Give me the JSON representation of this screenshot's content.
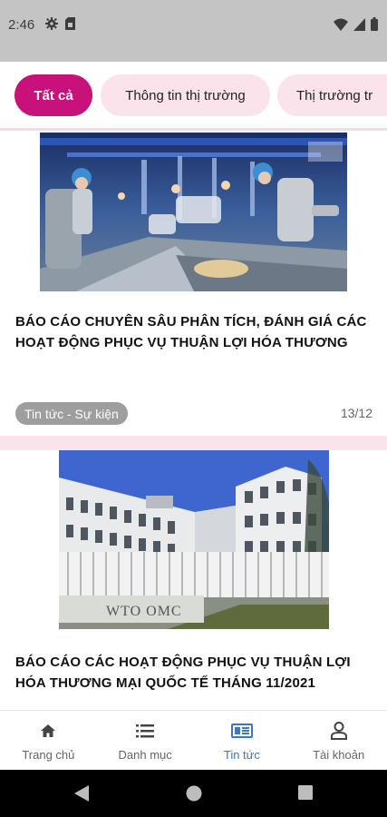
{
  "status_bar": {
    "time": "2:46",
    "icons": [
      "gear-icon",
      "sim-card-icon",
      "wifi-icon",
      "signal-icon",
      "battery-icon"
    ]
  },
  "filters": {
    "chips": [
      {
        "label": "Tất cả",
        "active": true
      },
      {
        "label": "Thông tin thị trường",
        "active": false
      },
      {
        "label": "Thị trường tr",
        "active": false
      }
    ]
  },
  "articles": [
    {
      "title": "BÁO CÁO CHUYÊN SÂU PHÂN TÍCH, ĐÁNH GIÁ CÁC HOẠT ĐỘNG PHỤC VỤ THUẬN LỢI HÓA THƯƠNG",
      "tag": "Tin tức - Sự kiện",
      "date": "13/12",
      "image": "factory-workers-photo"
    },
    {
      "title": "BÁO CÁO CÁC HOẠT ĐỘNG PHỤC VỤ THUẬN LỢI HÓA THƯƠNG MẠI QUỐC TẾ THÁNG 11/2021",
      "image": "wto-building-photo",
      "image_sign": "WTO OMC"
    }
  ],
  "bottom_nav": {
    "items": [
      {
        "label": "Trang chủ",
        "icon": "home-icon",
        "active": false
      },
      {
        "label": "Danh mục",
        "icon": "list-icon",
        "active": false
      },
      {
        "label": "Tin tức",
        "icon": "newspaper-icon",
        "active": true
      },
      {
        "label": "Tài khoản",
        "icon": "account-icon",
        "active": false
      }
    ]
  },
  "colors": {
    "accent": "#c8117a",
    "chip_bg": "#fbe3ec",
    "active_nav": "#3a76c9",
    "status_bar": "#c4c4c4"
  }
}
